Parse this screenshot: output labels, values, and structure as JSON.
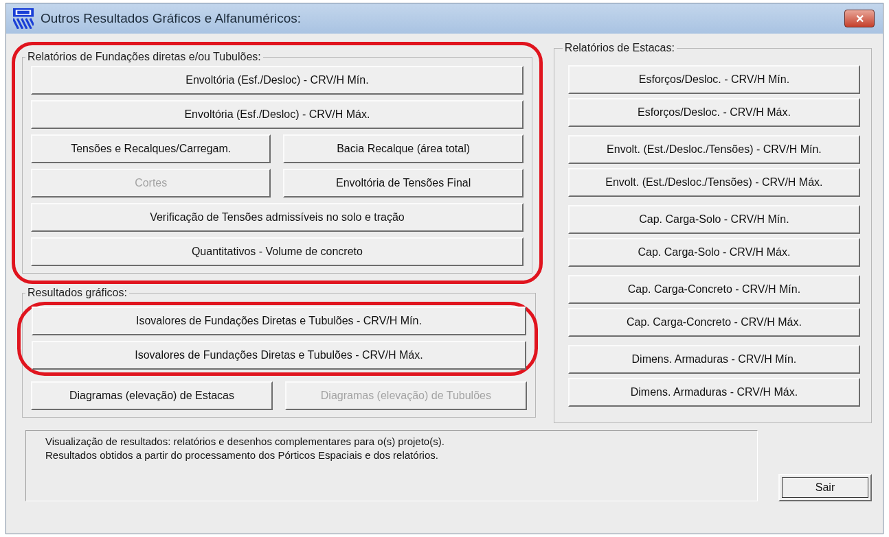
{
  "window": {
    "title": "Outros Resultados Gráficos e Alfanuméricos:",
    "close_label": "✕"
  },
  "left_groups": [
    {
      "title": "Relatórios de Fundações diretas e/ou Tubulões:",
      "highlighted": true,
      "sections": [
        {
          "highlighted": false,
          "rows": [
            [
              {
                "label": "Envoltória (Esf./Desloc) - CRV/H Mín.",
                "disabled": false
              }
            ],
            [
              {
                "label": "Envoltória (Esf./Desloc) - CRV/H Máx.",
                "disabled": false
              }
            ],
            [
              {
                "label": "Tensões e Recalques/Carregam.",
                "disabled": false
              },
              {
                "label": "Bacia Recalque (área total)",
                "disabled": false
              }
            ],
            [
              {
                "label": "Cortes",
                "disabled": true
              },
              {
                "label": "Envoltória de Tensões Final",
                "disabled": false
              }
            ],
            [
              {
                "label": "Verificação de Tensões admissíveis no solo e tração",
                "disabled": false
              }
            ],
            [
              {
                "label": "Quantitativos - Volume de concreto",
                "disabled": false
              }
            ]
          ]
        }
      ]
    },
    {
      "title": "Resultados gráficos:",
      "highlighted": false,
      "sections": [
        {
          "highlighted": true,
          "rows": [
            [
              {
                "label": "Isovalores de Fundações Diretas e Tubulões - CRV/H Mín.",
                "disabled": false
              }
            ],
            [
              {
                "label": "Isovalores de Fundações Diretas e Tubulões - CRV/H Máx.",
                "disabled": false
              }
            ]
          ]
        },
        {
          "highlighted": false,
          "rows": [
            [
              {
                "label": "Diagramas (elevação) de Estacas",
                "disabled": false
              },
              {
                "label": "Diagramas (elevação) de Tubulões",
                "disabled": true
              }
            ]
          ]
        }
      ]
    }
  ],
  "right_group": {
    "title": "Relatórios de Estacas:",
    "pairs": [
      [
        {
          "label": "Esforços/Desloc. - CRV/H Mín.",
          "disabled": false
        },
        {
          "label": "Esforços/Desloc. - CRV/H Máx.",
          "disabled": false
        }
      ],
      [
        {
          "label": "Envolt. (Est./Desloc./Tensões) - CRV/H Mín.",
          "disabled": false
        },
        {
          "label": "Envolt. (Est./Desloc./Tensões) - CRV/H Máx.",
          "disabled": false
        }
      ],
      [
        {
          "label": "Cap. Carga-Solo - CRV/H Mín.",
          "disabled": false
        },
        {
          "label": "Cap. Carga-Solo - CRV/H Máx.",
          "disabled": false
        }
      ],
      [
        {
          "label": "Cap. Carga-Concreto - CRV/H Mín.",
          "disabled": false
        },
        {
          "label": "Cap. Carga-Concreto - CRV/H Máx.",
          "disabled": false
        }
      ],
      [
        {
          "label": "Dimens. Armaduras - CRV/H Mín.",
          "disabled": false
        },
        {
          "label": "Dimens. Armaduras - CRV/H Máx.",
          "disabled": false
        }
      ]
    ]
  },
  "description": [
    "Visualização de resultados: relatórios e desenhos complementares para o(s) projeto(s).",
    "Resultados obtidos a partir do processamento dos Pórticos Espaciais e dos relatórios."
  ],
  "exit_button": "Sair"
}
